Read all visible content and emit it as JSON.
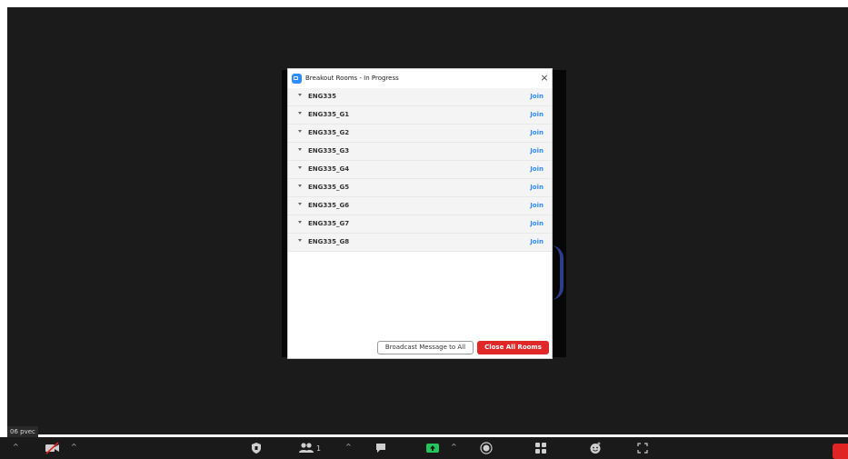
{
  "dialog": {
    "title": "Breakout Rooms - In Progress",
    "close_glyph": "×",
    "rooms": [
      {
        "name": "ENG335",
        "action": "Join"
      },
      {
        "name": "ENG335_G1",
        "action": "Join"
      },
      {
        "name": "ENG335_G2",
        "action": "Join"
      },
      {
        "name": "ENG335_G3",
        "action": "Join"
      },
      {
        "name": "ENG335_G4",
        "action": "Join"
      },
      {
        "name": "ENG335_G5",
        "action": "Join"
      },
      {
        "name": "ENG335_G6",
        "action": "Join"
      },
      {
        "name": "ENG335_G7",
        "action": "Join"
      },
      {
        "name": "ENG335_G8",
        "action": "Join"
      }
    ],
    "broadcast_label": "Broadcast Message to All",
    "close_all_label": "Close All Rooms"
  },
  "meeting": {
    "participant_name_tag": "06 pvec"
  },
  "toolbar": {
    "participants_count": "1",
    "icons": [
      "start-video-icon",
      "security-icon",
      "participants-icon",
      "chat-icon",
      "share-screen-icon",
      "record-icon",
      "breakout-rooms-icon",
      "reactions-icon",
      "apps-icon"
    ]
  },
  "colors": {
    "accent": "#2d8cff",
    "danger": "#e02828",
    "toolbar_bg": "#1a1a1a",
    "meeting_bg": "#1b1b1b"
  }
}
